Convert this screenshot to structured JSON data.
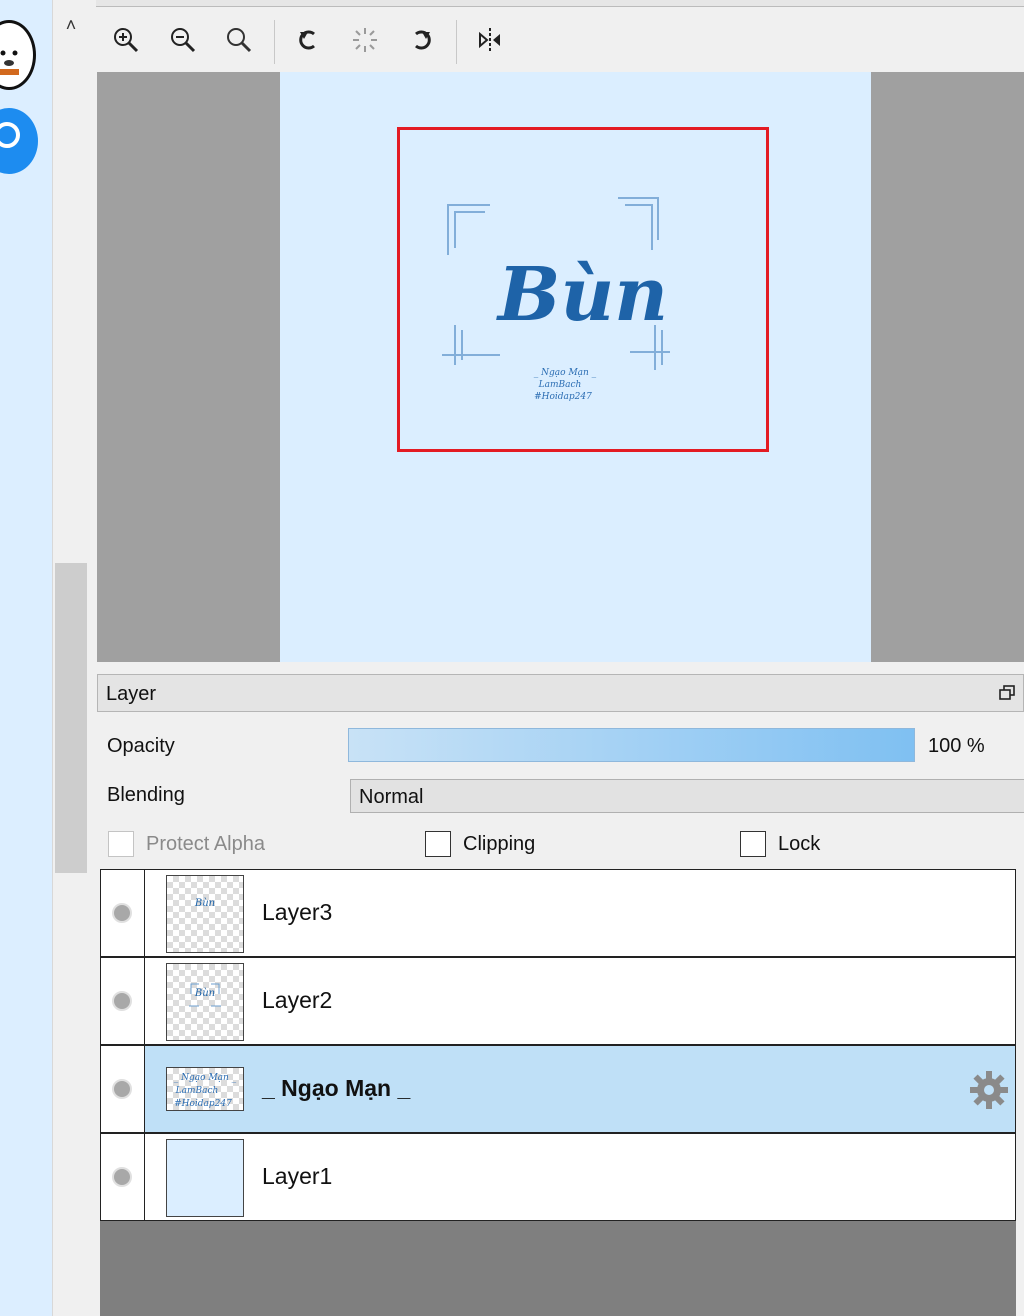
{
  "preview": {
    "title_art": "Bùn",
    "caption_lines": [
      "_ Ngạo Mạn _",
      "LamBach",
      "#Hoidap247"
    ]
  },
  "toolbar": {
    "buttons": [
      "zoom-in-icon",
      "zoom-out-icon",
      "zoom-reset-icon",
      "rotate-left-icon",
      "rotate-reset-icon",
      "rotate-right-icon",
      "flip-horizontal-icon"
    ]
  },
  "layer_panel": {
    "title": "Layer",
    "opacity_label": "Opacity",
    "opacity_value": "100 %",
    "opacity": 1.0,
    "blending_label": "Blending",
    "blending_value": "Normal",
    "protect_alpha_label": "Protect Alpha",
    "clipping_label": "Clipping",
    "lock_label": "Lock",
    "layers": [
      {
        "name": "Layer3",
        "selected": false
      },
      {
        "name": "Layer2",
        "selected": false
      },
      {
        "name": "_ Ngạo Mạn _",
        "selected": true
      },
      {
        "name": "Layer1",
        "selected": false
      }
    ]
  },
  "colors": {
    "accent": "#1d8cf0",
    "selection_border": "#e31b23",
    "selected_row": "#bfe0f7",
    "paper": "#dbeeff"
  }
}
